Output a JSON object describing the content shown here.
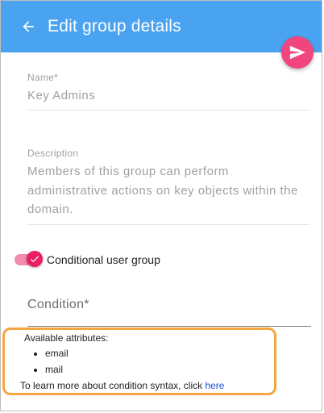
{
  "appbar": {
    "title": "Edit group details",
    "color": "#4aa3f0",
    "back_icon": "arrow-left-icon"
  },
  "fab": {
    "icon": "send-icon",
    "color": "#f0457d"
  },
  "form": {
    "name": {
      "label": "Name*",
      "value": "Key Admins"
    },
    "description": {
      "label": "Description",
      "value": "Members of this group can perform administrative actions on key objects within the domain."
    },
    "conditional": {
      "label": "Conditional user group",
      "checked": true,
      "accent": "#e91e63"
    },
    "condition": {
      "label": "Condition*"
    }
  },
  "hint": {
    "heading": "Available attributes:",
    "attributes": [
      "email",
      "mail"
    ],
    "learn_text": "To learn more about condition syntax, click ",
    "learn_link": "here",
    "border_color": "#f4a640"
  }
}
